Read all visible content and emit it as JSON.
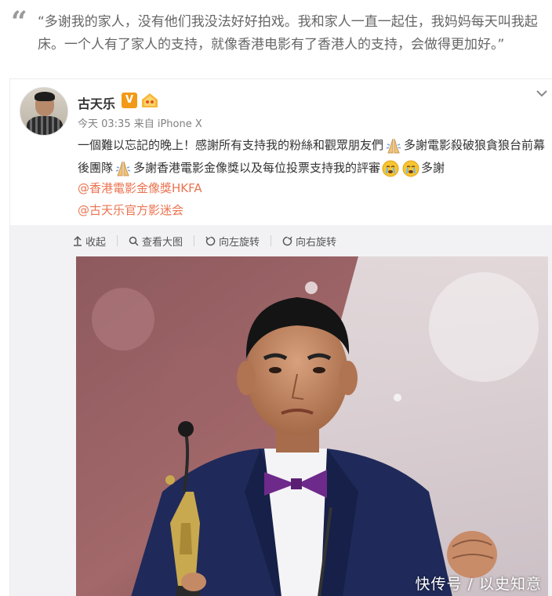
{
  "quote": {
    "text": "“多谢我的家人，没有他们我没法好好拍戏。我和家人一直一起住，我妈妈每天叫我起床。一个人有了家人的支持，就像香港电影有了香港人的支持，会做得更加好。”"
  },
  "post": {
    "username": "古天乐",
    "vip_badge": "V",
    "meta": "今天 03:35 来自 iPhone X",
    "text_part1": "一個難以忘記的晚上！感謝所有支持我的粉絲和觀眾朋友們",
    "text_part2": "多謝電影殺破狼貪狼台前幕後團隊",
    "text_part3": "多謝香港電影金像獎以及每位投票支持我的評審",
    "text_part4": "多謝",
    "mentions": [
      "@香港電影金像獎HKFA",
      "@古天乐官方影迷会"
    ]
  },
  "toolbar": {
    "collapse": "收起",
    "view_large": "查看大图",
    "rotate_left": "向左旋转",
    "rotate_right": "向右旋转"
  },
  "watermark": "快传号 / 以史知意",
  "icons": {
    "quote_mark": "quote-mark-icon",
    "praying_hands": "praying-hands-icon",
    "crying_face": "crying-face-icon",
    "chevron_down": "chevron-down-icon"
  },
  "colors": {
    "mention": "#eb7350",
    "vip": "#f29a18",
    "toolbar_bg": "#f2f2f5"
  }
}
